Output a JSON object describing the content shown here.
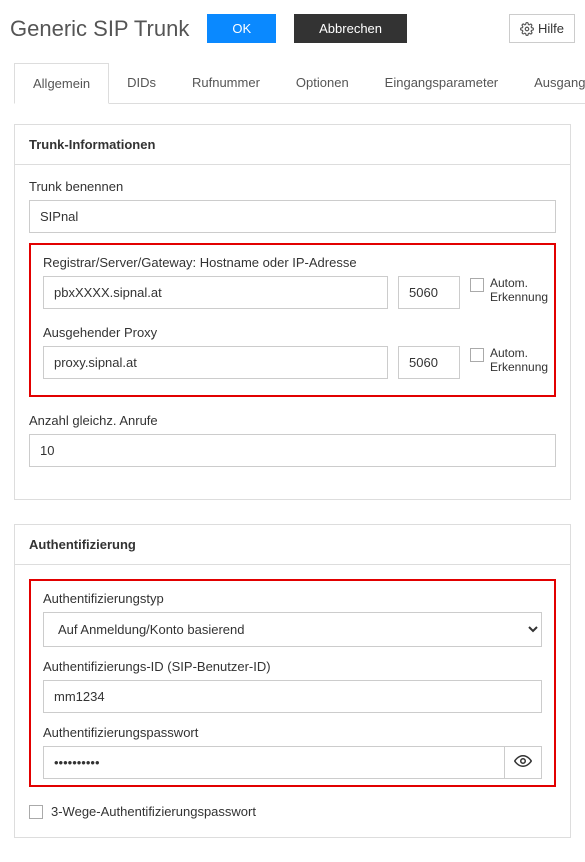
{
  "header": {
    "title": "Generic SIP Trunk",
    "ok": "OK",
    "cancel": "Abbrechen",
    "help": "Hilfe"
  },
  "tabs": {
    "t0": "Allgemein",
    "t1": "DIDs",
    "t2": "Rufnummer",
    "t3": "Optionen",
    "t4": "Eingangsparameter",
    "t5": "Ausgangsparameter"
  },
  "trunk": {
    "panel_title": "Trunk-Informationen",
    "name_label": "Trunk benennen",
    "name_value": "SIPnal",
    "registrar_label": "Registrar/Server/Gateway: Hostname oder IP-Adresse",
    "registrar_value": "pbxXXXX.sipnal.at",
    "registrar_port": "5060",
    "auto_detect1": "Autom. Erkennung",
    "proxy_label": "Ausgehender Proxy",
    "proxy_value": "proxy.sipnal.at",
    "proxy_port": "5060",
    "auto_detect2": "Autom. Erkennung",
    "calls_label": "Anzahl gleichz. Anrufe",
    "calls_value": "10"
  },
  "auth": {
    "panel_title": "Authentifizierung",
    "type_label": "Authentifizierungstyp",
    "type_value": "Auf Anmeldung/Konto basierend",
    "id_label": "Authentifizierungs-ID (SIP-Benutzer-ID)",
    "id_value": "mm1234",
    "pw_label": "Authentifizierungspasswort",
    "pw_value": "••••••••••",
    "threeway_label": "3-Wege-Authentifizierungspasswort"
  }
}
